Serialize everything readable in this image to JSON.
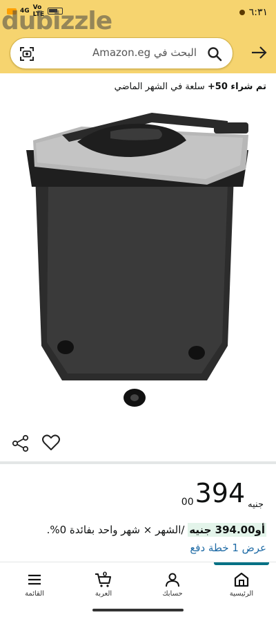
{
  "status_bar": {
    "time": "٦:٣١",
    "network": "4G",
    "signal_label_1": "Vo",
    "signal_label_2": "LTE"
  },
  "watermark": "dubizzle",
  "search": {
    "placeholder": "البحث في Amazon.eg"
  },
  "product": {
    "bought_bold": "تم شراء 50+",
    "bought_rest": " سلعة في الشهر الماضي"
  },
  "price": {
    "currency": "جنيه",
    "whole": "394",
    "fraction": "00"
  },
  "installment": {
    "prefix": "أو",
    "amount": "394.00 جنيه",
    "rest": " /الشهر × شهر واحد بفائدة 0%."
  },
  "plan_link": "عرض 1 خطة دفع",
  "nav": {
    "home": "الرئيسية",
    "account": "حسابك",
    "cart": "العربة",
    "cart_count": "0",
    "menu": "القائمة"
  },
  "colors": {
    "header": "#f6d46f",
    "link": "#1d6aa5",
    "active_tab": "#007185"
  }
}
